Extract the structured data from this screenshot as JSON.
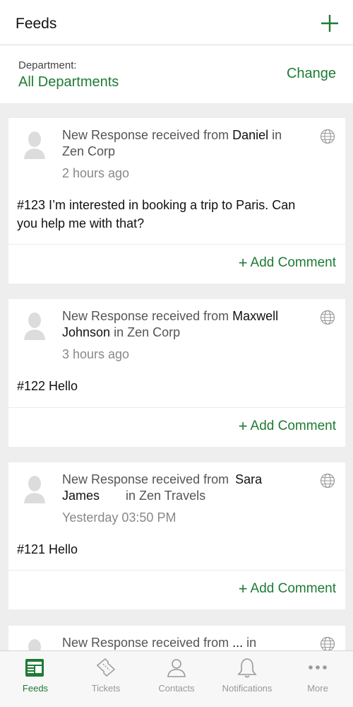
{
  "header": {
    "title": "Feeds",
    "add_icon": "plus-icon"
  },
  "department": {
    "label": "Department:",
    "value": "All Departments",
    "change": "Change"
  },
  "colors": {
    "accent": "#1e7b34",
    "muted": "#888888"
  },
  "feeds": [
    {
      "prefix": "New Response received from",
      "name": "Daniel",
      "suffix": "in",
      "line2": "Zen Corp",
      "time": "2 hours ago",
      "message_line1": "#123 I’m interested in booking a trip to Paris. Can",
      "message_line2": "you help me with that?",
      "comment": "Add Comment"
    },
    {
      "prefix": "New Response received from",
      "name": "Maxwell",
      "name2": "Johnson",
      "suffix": "in Zen Corp",
      "time": "3 hours ago",
      "message": "#122 Hello",
      "comment": "Add Comment"
    },
    {
      "prefix": "New Response received from",
      "name": "Sara",
      "name2": "James",
      "suffix": "in Zen Travels",
      "time": "Yesterday 03:50 PM",
      "message": "#121 Hello",
      "comment": "Add Comment"
    },
    {
      "prefix": "New Response received from",
      "name": "...",
      "suffix": "in"
    }
  ],
  "tabs": [
    {
      "label": "Feeds",
      "icon": "feeds-icon",
      "active": true
    },
    {
      "label": "Tickets",
      "icon": "tickets-icon",
      "active": false
    },
    {
      "label": "Contacts",
      "icon": "contacts-icon",
      "active": false
    },
    {
      "label": "Notifications",
      "icon": "bell-icon",
      "active": false
    },
    {
      "label": "More",
      "icon": "more-icon",
      "active": false
    }
  ]
}
